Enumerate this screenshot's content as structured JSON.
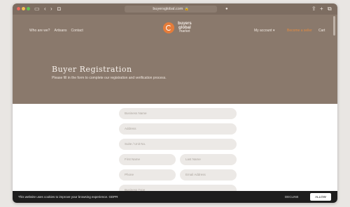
{
  "browser": {
    "url": "buyersglobal.com",
    "tab_icons": [
      "sidebar-icon",
      "back-icon",
      "forward-icon",
      "shield-icon"
    ],
    "right_icons": [
      "share-icon",
      "new-tab-icon",
      "tabs-icon"
    ]
  },
  "header": {
    "nav": [
      "Who are we?",
      "Artisans",
      "Contact"
    ],
    "logo_line1": "buyers",
    "logo_line2": "global",
    "logo_line3": "market",
    "account": "My account ▾",
    "orange_link": "Become a seller",
    "cart": "Cart"
  },
  "hero": {
    "title": "Buyer Registration",
    "subtitle": "Please fill in the form to complete our registration and verification process."
  },
  "form": {
    "business_name": "Business Name",
    "address": "Address",
    "suite": "Suite / Unit No.",
    "first_name": "First Name",
    "last_name": "Last Name",
    "phone": "Phone",
    "email": "Email Address",
    "business_type": "Business Type"
  },
  "cookie": {
    "text": "This website uses cookies to improve your browsing experience. GDPR",
    "decline": "DECLINE",
    "allow": "ALLOW"
  }
}
